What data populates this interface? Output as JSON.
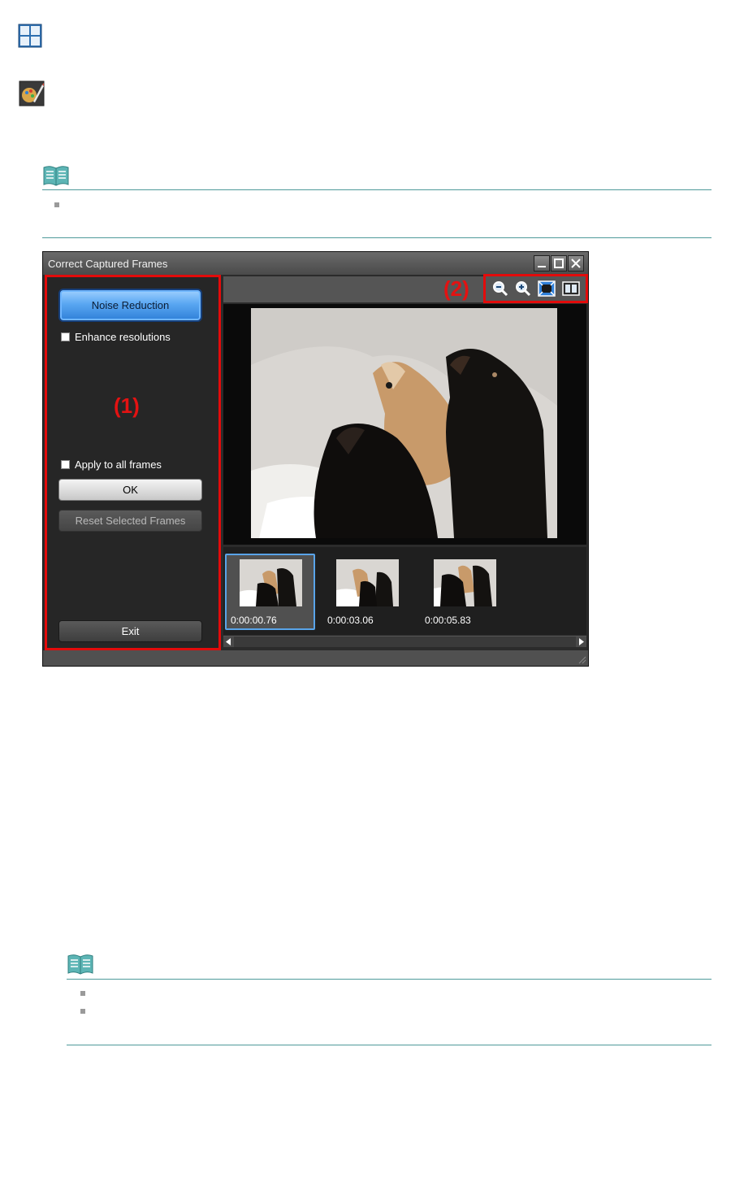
{
  "window": {
    "title": "Correct Captured Frames",
    "controls": [
      "minimize-icon",
      "maximize-icon",
      "close-icon"
    ]
  },
  "annotations": {
    "panel_label": "(1)",
    "toolbar_label": "(2)"
  },
  "left_panel": {
    "noise_reduction_label": "Noise Reduction",
    "enhance_resolutions_label": "Enhance resolutions",
    "apply_all_label": "Apply to all frames",
    "ok_label": "OK",
    "reset_label": "Reset Selected Frames",
    "exit_label": "Exit"
  },
  "toolbar": {
    "icons": [
      "zoom-out-icon",
      "zoom-in-icon",
      "full-screen-icon",
      "compare-icon"
    ]
  },
  "thumbnails": [
    {
      "time": "0:00:00.76",
      "selected": true
    },
    {
      "time": "0:00:03.06",
      "selected": false
    },
    {
      "time": "0:00:05.83",
      "selected": false
    }
  ],
  "colors": {
    "annotation_red": "#e30b0b",
    "selection_blue": "#59a4e9",
    "primary_button": "#5aa7f2",
    "note_rule": "#4f9a9a"
  }
}
